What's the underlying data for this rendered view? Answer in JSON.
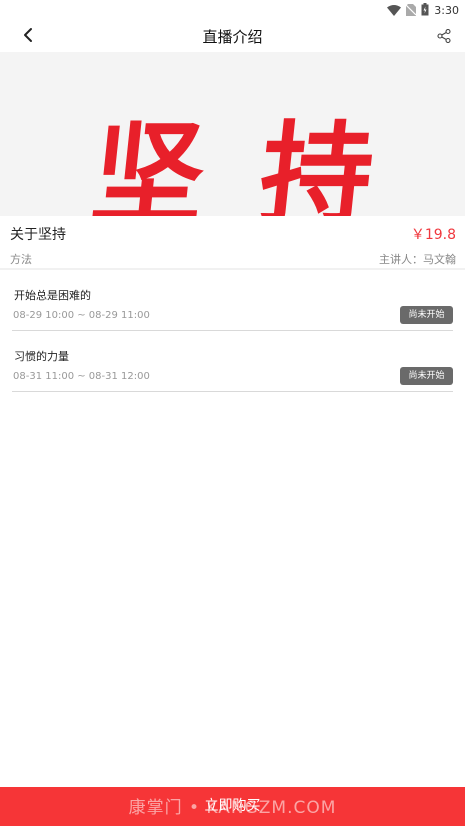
{
  "status_bar": {
    "time": "3:30",
    "icons": [
      "wifi-icon",
      "no-sim-icon",
      "battery-icon"
    ]
  },
  "nav": {
    "title": "直播介绍",
    "back_icon": "chevron-left-icon",
    "share_icon": "share-icon"
  },
  "banner": {
    "text": "坚持"
  },
  "course": {
    "title": "关于坚持",
    "price": "￥19.8",
    "category": "方法",
    "lecturer_label": "主讲人：",
    "lecturer_name": "马文翰"
  },
  "sessions": [
    {
      "title": "开始总是困难的",
      "time": "08-29 10:00 ~ 08-29 11:00",
      "status": "尚未开始"
    },
    {
      "title": "习惯的力量",
      "time": "08-31 11:00 ~ 08-31 12:00",
      "status": "尚未开始"
    }
  ],
  "footer": {
    "buy_label": "立即购买",
    "watermark": "康掌门 • KANGZM.COM"
  },
  "colors": {
    "accent": "#f63537",
    "price": "#f0383e",
    "badge": "#6a6a6a"
  }
}
